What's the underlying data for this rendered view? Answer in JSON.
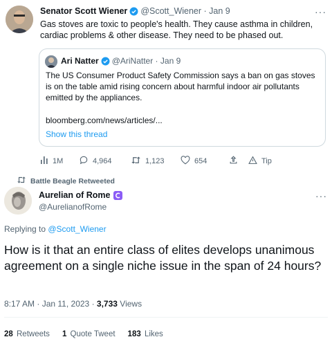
{
  "tweet1": {
    "name": "Senator Scott Wiener",
    "handle": "@Scott_Wiener",
    "date": "Jan 9",
    "text": "Gas stoves are toxic to people's health. They cause asthma in children, cardiac problems & other disease. They need to be phased out.",
    "more_icon": "more-icon"
  },
  "quote": {
    "name": "Ari Natter",
    "handle": "@AriNatter",
    "date": "Jan 9",
    "text": "The US Consumer Product Safety Commission says a ban on gas stoves is on the table amid rising concern about harmful indoor air pollutants emitted by the appliances.",
    "link": "bloomberg.com/news/articles/...",
    "show_thread": "Show this thread"
  },
  "actions": {
    "views": "1M",
    "replies": "4,964",
    "retweets": "1,123",
    "likes": "654",
    "tip": "Tip"
  },
  "retweeted_by": "Battle Beagle Retweeted",
  "tweet2": {
    "name": "Aurelian of Rome",
    "handle": "@AurelianofRome",
    "replying_prefix": "Replying to ",
    "replying_to": "@Scott_Wiener",
    "text": "How is it that an entire class of elites develops unanimous agreement on a single niche issue in the span of 24 hours?",
    "time": "8:17 AM",
    "date": "Jan 11, 2023",
    "views_count": "3,733",
    "views_label": "Views"
  },
  "stats": {
    "retweets_count": "28",
    "retweets_label": "Retweets",
    "quote_count": "1",
    "quote_label": "Quote Tweet",
    "likes_count": "183",
    "likes_label": "Likes"
  },
  "colors": {
    "accent": "#1d9bf0",
    "text": "#0f1419",
    "secondary": "#536471",
    "border": "#cfd9de",
    "badge": "#8b5cf6"
  }
}
